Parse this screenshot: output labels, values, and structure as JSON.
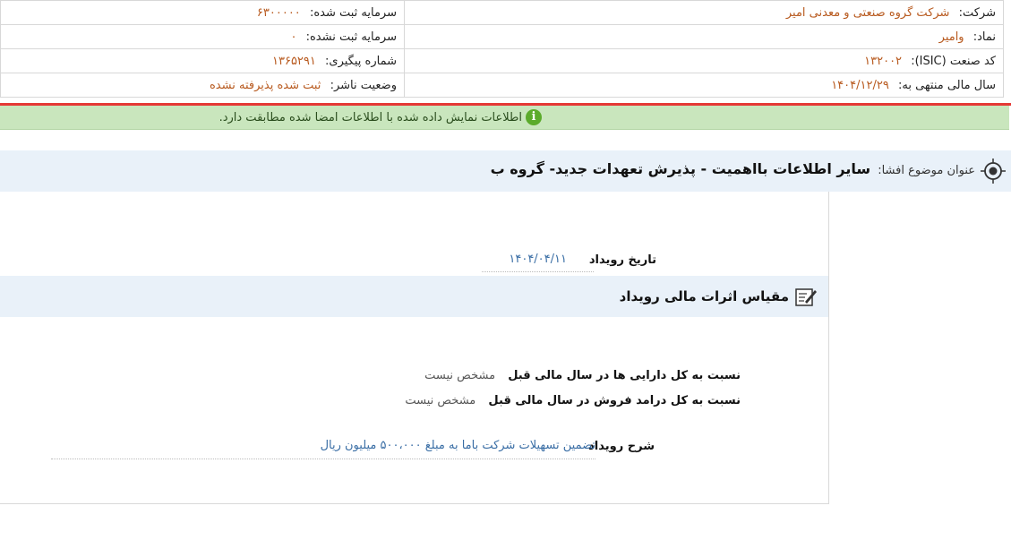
{
  "header": {
    "company_label": "شرکت:",
    "company_value": "شرکت گروه صنعتی و معدنی امیر",
    "capital_reg_label": "سرمایه ثبت شده:",
    "capital_reg_value": "۶۳۰۰۰۰۰",
    "symbol_label": "نماد:",
    "symbol_value": "وامیر",
    "capital_unreg_label": "سرمایه ثبت نشده:",
    "capital_unreg_value": "۰",
    "isic_label": "کد صنعت (ISIC):",
    "isic_value": "۱۳۲۰۰۲",
    "tracking_label": "شماره پیگیری:",
    "tracking_value": "۱۳۶۵۲۹۱",
    "fiscal_label": "سال مالی منتهی به:",
    "fiscal_value": "۱۴۰۴/۱۲/۲۹",
    "status_label": "وضعیت ناشر:",
    "status_value": "ثبت شده پذیرفته نشده"
  },
  "notice": {
    "icon": "info-icon",
    "text": "اطلاعات نمایش داده شده با اطلاعات امضا شده مطابقت دارد."
  },
  "subject": {
    "icon": "target-icon",
    "label": "عنوان موضوع افشا:",
    "value": "سایر اطلاعات بااهمیت - پذیرش تعهدات جدید- گروه ب"
  },
  "event": {
    "date_label": "تاریخ رویداد",
    "date_value": "۱۴۰۴/۰۴/۱۱"
  },
  "financial_section": {
    "icon": "edit-icon",
    "title": "مقیاس اثرات مالی رویداد",
    "assets_label": "نسبت به کل دارایی ها در سال مالی قبل",
    "assets_value": "مشخص نیست",
    "sales_label": "نسبت به کل درامد فروش در سال مالی قبل",
    "sales_value": "مشخص نیست"
  },
  "description": {
    "label": "شرح رویداد",
    "value": "تضمین تسهیلات شرکت باما به مبلغ ۵۰۰،۰۰۰ میلیون ریال"
  },
  "colors": {
    "value_orange": "#b85a1f",
    "value_blue": "#3a6ea5",
    "notice_bg": "#c9e6bd",
    "alert_red": "#e53935",
    "bar_bg": "#e9f1f9"
  }
}
